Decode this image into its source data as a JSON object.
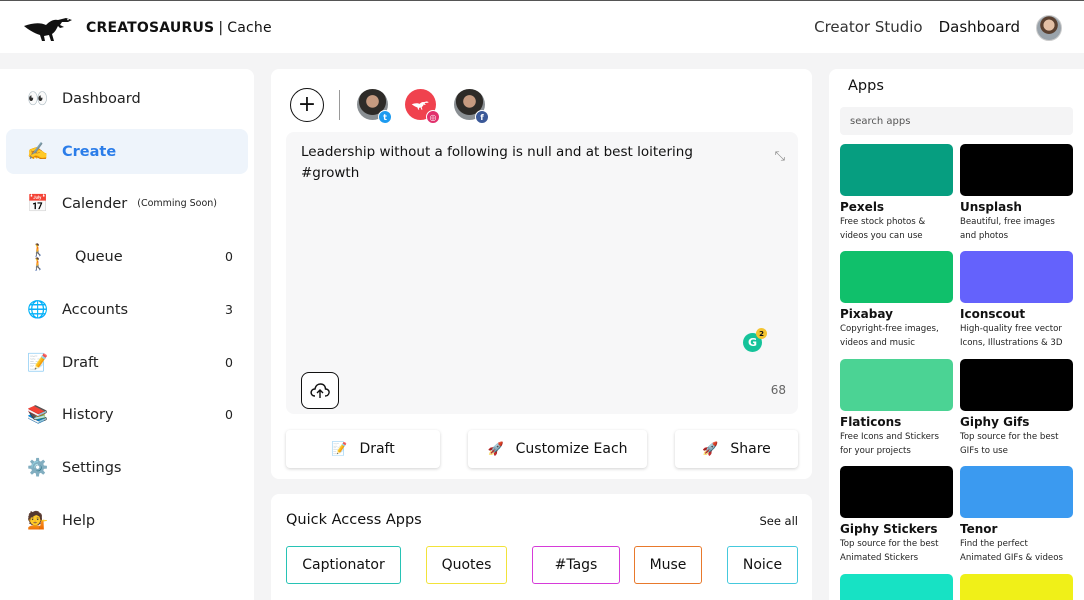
{
  "header": {
    "brand_bold": "CREATOSAURUS",
    "brand_separator": "|",
    "brand_suffix": "Cache",
    "nav": [
      "Creator Studio",
      "Dashboard"
    ],
    "logo_icon": "dinosaur-logo-icon",
    "avatar_icon": "user-avatar"
  },
  "sidebar": {
    "items": [
      {
        "icon": "👀",
        "icon_name": "eyes-icon",
        "label": "Dashboard",
        "sub": "",
        "count": ""
      },
      {
        "icon": "✍️",
        "icon_name": "writing-hand-icon",
        "label": "Create",
        "sub": "",
        "count": ""
      },
      {
        "icon": "📅",
        "icon_name": "calendar-icon",
        "label": "Calender",
        "sub": "(Comming Soon)",
        "count": ""
      },
      {
        "icon": "🚶🚶",
        "icon_name": "walking-people-icon",
        "label": "Queue",
        "sub": "",
        "count": "0"
      },
      {
        "icon": "🌐",
        "icon_name": "globe-icon",
        "label": "Accounts",
        "sub": "",
        "count": "3"
      },
      {
        "icon": "📝",
        "icon_name": "memo-icon",
        "label": "Draft",
        "sub": "",
        "count": "0"
      },
      {
        "icon": "📚",
        "icon_name": "books-icon",
        "label": "History",
        "sub": "",
        "count": "0"
      },
      {
        "icon": "⚙️",
        "icon_name": "gear-icon",
        "label": "Settings",
        "sub": "",
        "count": ""
      },
      {
        "icon": "💁",
        "icon_name": "help-person-icon",
        "label": "Help",
        "sub": "",
        "count": ""
      }
    ],
    "active": "Create",
    "active_color": "#2b7de9"
  },
  "composer": {
    "add_symbol": "+",
    "accounts": [
      {
        "type": "photo",
        "network": "twitter",
        "badge": "t"
      },
      {
        "type": "brand",
        "network": "instagram",
        "badge": "◎"
      },
      {
        "type": "photo",
        "network": "facebook",
        "badge": "f"
      }
    ],
    "text_line1": "Leadership without a following is null and at best loitering",
    "text_line2": "#growth",
    "grammarly_letter": "G",
    "grammarly_count": "2",
    "char_count": "68",
    "actions": {
      "draft": {
        "icon": "📝",
        "label": "Draft"
      },
      "customize": {
        "icon": "🚀",
        "label": "Customize Each"
      },
      "share": {
        "icon": "🚀",
        "label": "Share"
      }
    }
  },
  "quick_access": {
    "title": "Quick Access Apps",
    "see_all": "See all",
    "chips": [
      {
        "label": "Captionator",
        "color": "#27c3b5"
      },
      {
        "label": "Quotes",
        "color": "#f2e33a"
      },
      {
        "label": "#Tags",
        "color": "#d63bd9"
      },
      {
        "label": "Muse",
        "color": "#e8792c"
      },
      {
        "label": "Noice",
        "color": "#45c9dd"
      }
    ]
  },
  "apps": {
    "title": "Apps",
    "search_placeholder": "search apps",
    "items": [
      {
        "name": "Pexels",
        "desc1": "Free stock photos &",
        "desc2": "videos you can use",
        "color": "#069e80"
      },
      {
        "name": "Unsplash",
        "desc1": "Beautiful, free images",
        "desc2": "and photos",
        "color": "#000000"
      },
      {
        "name": "Pixabay",
        "desc1": "Copyright-free images,",
        "desc2": "videos and music",
        "color": "#10c06b"
      },
      {
        "name": "Iconscout",
        "desc1": "High-quality free vector",
        "desc2": "Icons, Illustrations & 3D",
        "color": "#6462fc"
      },
      {
        "name": "Flaticons",
        "desc1": "Free Icons and Stickers",
        "desc2": "for your projects",
        "color": "#4bd394"
      },
      {
        "name": "Giphy Gifs",
        "desc1": "Top source for the best",
        "desc2": "GIFs to use",
        "color": "#000000"
      },
      {
        "name": "Giphy Stickers",
        "desc1": "Top source for the best",
        "desc2": "Animated Stickers",
        "color": "#000000"
      },
      {
        "name": "Tenor",
        "desc1": "Find the perfect",
        "desc2": "Animated GIFs & videos",
        "color": "#3b9af0"
      },
      {
        "name": "",
        "desc1": "",
        "desc2": "",
        "color": "#17e2c4"
      },
      {
        "name": "",
        "desc1": "",
        "desc2": "",
        "color": "#f0f018"
      }
    ]
  }
}
